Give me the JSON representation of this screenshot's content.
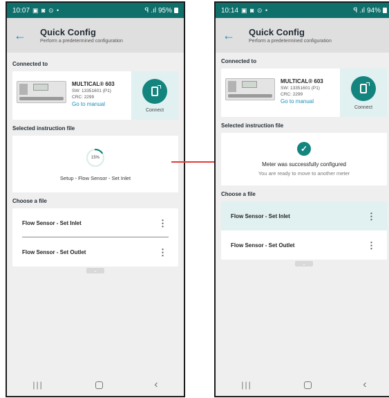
{
  "screens": [
    {
      "status": {
        "time": "10:07",
        "icons": "▣ ◙ ⊙ •",
        "signal": "ꟼ .ıl",
        "battery": "95%"
      },
      "header": {
        "title": "Quick Config",
        "subtitle": "Perform a predetermined configuration"
      },
      "connected": {
        "label": "Connected to",
        "device_name": "MULTICAL® 603",
        "sw": "SW: 13351601 (P1)",
        "crc": "CRC: 2299",
        "manual_link": "Go to manual",
        "connect_label": "Connect"
      },
      "instruction": {
        "label": "Selected instruction file",
        "progress_text": "15%",
        "progress_value": 0.15,
        "file_name": "Setup - Flow Sensor - Set Inlet"
      },
      "files": {
        "label": "Choose a file",
        "items": [
          {
            "name": "Flow Sensor - Set Inlet"
          },
          {
            "name": "Flow Sensor - Set Outlet"
          }
        ]
      }
    },
    {
      "status": {
        "time": "10:14",
        "icons": "▣ ◙ ⊙ •",
        "signal": "ꟼ .ıl",
        "battery": "94%"
      },
      "header": {
        "title": "Quick Config",
        "subtitle": "Perform a predetermined configuration"
      },
      "connected": {
        "label": "Connected to",
        "device_name": "MULTICAL® 603",
        "sw": "SW: 13351601 (P1)",
        "crc": "CRC: 2299",
        "manual_link": "Go to manual",
        "connect_label": "Connect"
      },
      "instruction": {
        "label": "Selected instruction file",
        "success_title": "Meter was successfully configured",
        "success_sub": "You are ready to move to another meter"
      },
      "files": {
        "label": "Choose a file",
        "items": [
          {
            "name": "Flow Sensor - Set Inlet"
          },
          {
            "name": "Flow Sensor - Set Outlet"
          }
        ]
      }
    }
  ],
  "colors": {
    "teal": "#13847e",
    "status_bar": "#0e6f6b",
    "link": "#1a8fb5",
    "arrow": "#e53935",
    "highlight": "#e1f0f0"
  },
  "icons": {
    "back": "arrow-left-icon",
    "connect": "phone-connect-icon",
    "kebab": "more-vertical-icon",
    "check": "checkmark-icon",
    "expand": "chevron-down-icon"
  }
}
